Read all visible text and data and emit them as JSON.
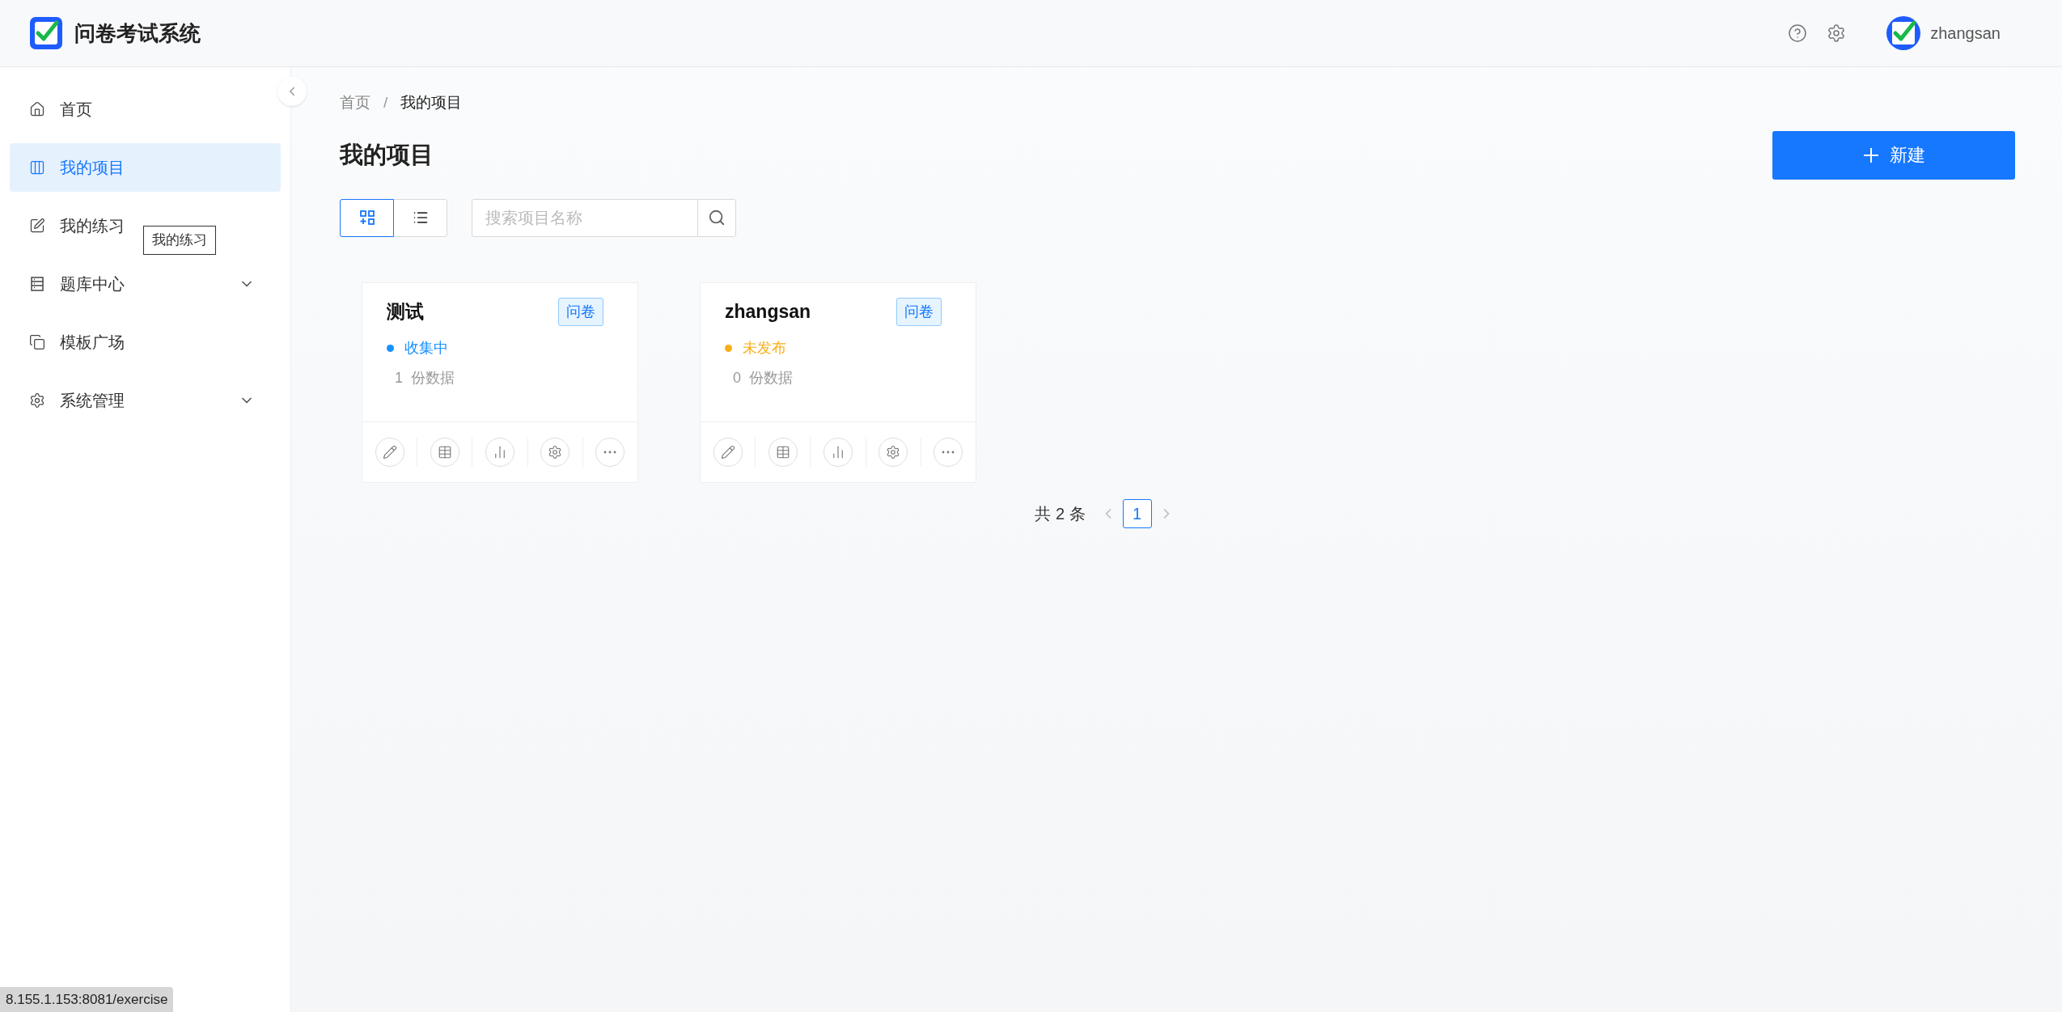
{
  "header": {
    "title": "问卷考试系统",
    "user": "zhangsan"
  },
  "sidebar": {
    "items": [
      {
        "label": "首页",
        "kind": "link",
        "selected": false
      },
      {
        "label": "我的项目",
        "kind": "link",
        "selected": true
      },
      {
        "label": "我的练习",
        "kind": "link",
        "selected": false
      },
      {
        "label": "题库中心",
        "kind": "group",
        "selected": false
      },
      {
        "label": "模板广场",
        "kind": "link",
        "selected": false
      },
      {
        "label": "系统管理",
        "kind": "group",
        "selected": false
      }
    ],
    "tooltip": "我的练习"
  },
  "breadcrumb": {
    "separator": "/",
    "items": [
      "首页",
      "我的项目"
    ]
  },
  "page_title": "我的项目",
  "new_button": "新建",
  "view_toggle": [
    {
      "kind": "grid",
      "selected": true
    },
    {
      "kind": "list",
      "selected": false
    }
  ],
  "search": {
    "placeholder": "搜索项目名称"
  },
  "cards": [
    {
      "title": "测试",
      "tag": "问卷",
      "status": "收集中",
      "color": "#1890ff",
      "count": "1",
      "count_label": "份数据"
    },
    {
      "title": "zhangsan",
      "tag": "问卷",
      "status": "未发布",
      "color": "#faad14",
      "count": "0",
      "count_label": "份数据"
    }
  ],
  "pagination": {
    "total": "共 2 条",
    "pages": [
      {
        "label": "1",
        "selected": true
      }
    ]
  },
  "status_url": "8.155.1.153:8081/exercise"
}
